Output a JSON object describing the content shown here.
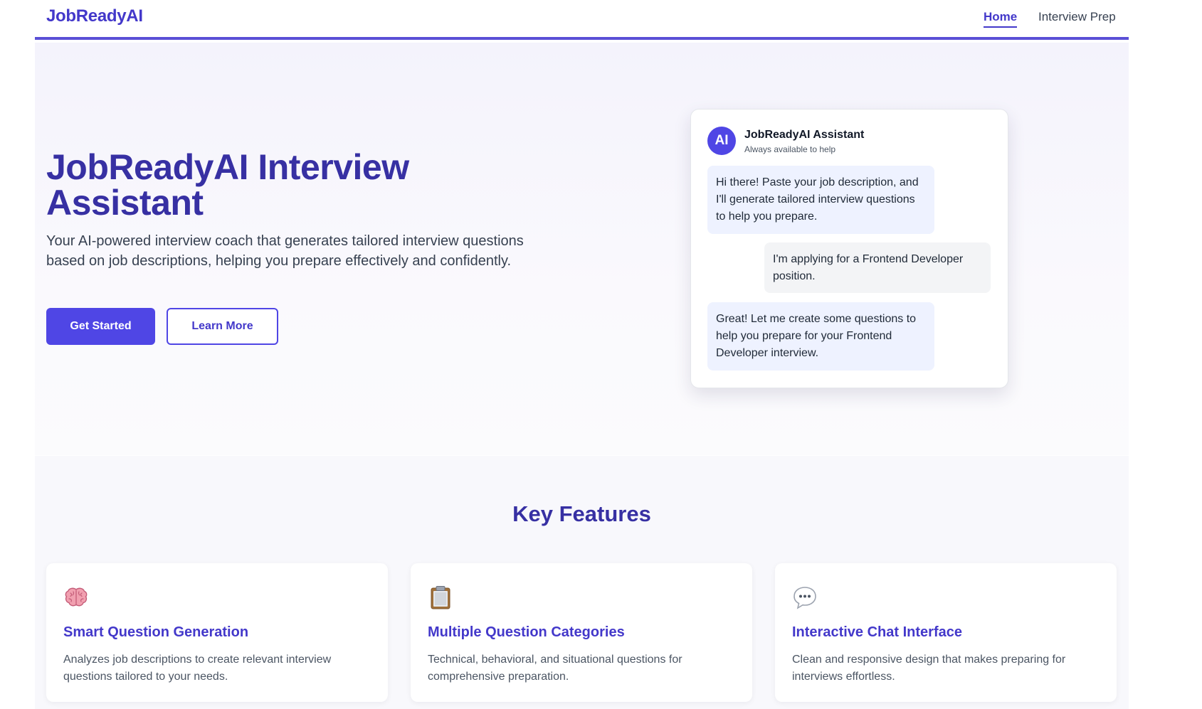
{
  "nav": {
    "brand": "JobReadyAI",
    "links": [
      {
        "label": "Home",
        "active": true
      },
      {
        "label": "Interview Prep",
        "active": false
      }
    ]
  },
  "hero": {
    "title": "JobReadyAI Interview Assistant",
    "subtitle": "Your AI-powered interview coach that generates tailored interview questions based on job descriptions, helping you prepare effectively and confidently.",
    "primary_cta": "Get Started",
    "secondary_cta": "Learn More"
  },
  "chat": {
    "avatar_text": "AI",
    "assistant_name": "JobReadyAI Assistant",
    "assistant_status": "Always available to help",
    "messages": [
      {
        "from": "ai",
        "text": "Hi there! Paste your job description, and I'll generate tailored interview questions to help you prepare."
      },
      {
        "from": "user",
        "text": "I'm applying for a Frontend Developer position."
      },
      {
        "from": "ai",
        "text": "Great! Let me create some questions to help you prepare for your Frontend Developer interview."
      }
    ]
  },
  "features": {
    "title": "Key Features",
    "items": [
      {
        "icon": "brain-icon",
        "title": "Smart Question Generation",
        "description": "Analyzes job descriptions to create relevant interview questions tailored to your needs."
      },
      {
        "icon": "clipboard-icon",
        "title": "Multiple Question Categories",
        "description": "Technical, behavioral, and situational questions for comprehensive preparation."
      },
      {
        "icon": "speech-bubble-icon",
        "title": "Interactive Chat Interface",
        "description": "Clean and responsive design that makes preparing for interviews effortless."
      }
    ]
  },
  "colors": {
    "brand": "#4338ca",
    "primary": "#4f46e5",
    "ai_bubble": "#eef2ff",
    "user_bubble": "#f3f4f6"
  }
}
